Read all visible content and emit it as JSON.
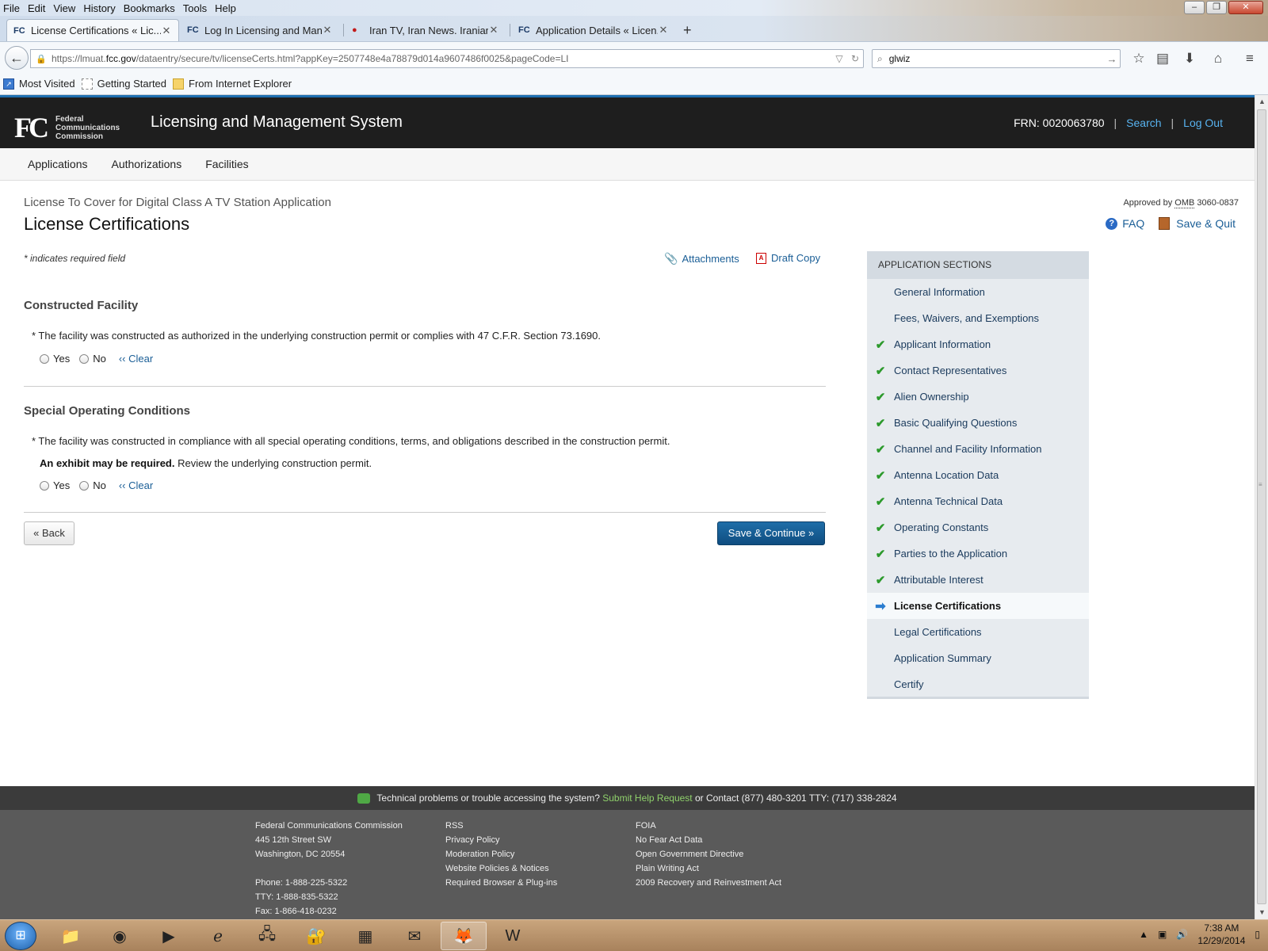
{
  "browser": {
    "menu": [
      "File",
      "Edit",
      "View",
      "History",
      "Bookmarks",
      "Tools",
      "Help"
    ],
    "tabs": [
      {
        "label": "License Certifications « Lic...",
        "favicon": "FC"
      },
      {
        "label": "Log In Licensing and Mana...",
        "favicon": "FC"
      },
      {
        "label": "Iran TV, Iran News. Iranian ...",
        "favicon": "●"
      },
      {
        "label": "Application Details « Licen...",
        "favicon": "FC"
      }
    ],
    "url_prefix": "https://lmuat.",
    "url_domain": "fcc.gov",
    "url_rest": "/dataentry/secure/tv/licenseCerts.html?appKey=2507748e4a78879d014a9607486f0025&pageCode=LI",
    "search_value": "glwiz",
    "bookmarks": [
      "Most Visited",
      "Getting Started",
      "From Internet Explorer"
    ]
  },
  "header": {
    "logo_mark": "FC",
    "agency_lines": [
      "Federal",
      "Communications",
      "Commission"
    ],
    "system_title": "Licensing and Management System",
    "frn": "FRN: 0020063780",
    "search_link": "Search",
    "logout_link": "Log Out"
  },
  "nav": [
    "Applications",
    "Authorizations",
    "Facilities"
  ],
  "page": {
    "subtitle": "License To Cover for Digital Class A TV Station Application",
    "title": "License Certifications",
    "omb_prefix": "Approved by",
    "omb_abbr": "OMB",
    "omb_number": "3060-0837",
    "faq": "FAQ",
    "save_quit": "Save & Quit",
    "required_note": "* indicates required field",
    "attachments": "Attachments",
    "draft_copy": "Draft Copy",
    "sections": [
      {
        "heading": "Constructed Facility",
        "question": "* The facility was constructed as authorized in the underlying construction permit or complies with 47 C.F.R. Section 73.1690."
      },
      {
        "heading": "Special Operating Conditions",
        "question": "* The facility was constructed in compliance with all special operating conditions, terms, and obligations described in the construction permit.",
        "exhibit_bold": "An exhibit may be required.",
        "exhibit_rest": " Review the underlying construction permit."
      }
    ],
    "yes": "Yes",
    "no": "No",
    "clear": "‹‹ Clear",
    "back": "« Back",
    "save_continue": "Save & Continue »"
  },
  "sidebar": {
    "heading": "Application Sections",
    "items": [
      {
        "label": "General Information",
        "status": "none"
      },
      {
        "label": "Fees, Waivers, and Exemptions",
        "status": "none"
      },
      {
        "label": "Applicant Information",
        "status": "complete"
      },
      {
        "label": "Contact Representatives",
        "status": "complete"
      },
      {
        "label": "Alien Ownership",
        "status": "complete"
      },
      {
        "label": "Basic Qualifying Questions",
        "status": "complete"
      },
      {
        "label": "Channel and Facility Information",
        "status": "complete"
      },
      {
        "label": "Antenna Location Data",
        "status": "complete"
      },
      {
        "label": "Antenna Technical Data",
        "status": "complete"
      },
      {
        "label": "Operating Constants",
        "status": "complete"
      },
      {
        "label": "Parties to the Application",
        "status": "complete"
      },
      {
        "label": "Attributable Interest",
        "status": "complete"
      },
      {
        "label": "License Certifications",
        "status": "current"
      },
      {
        "label": "Legal Certifications",
        "status": "none"
      },
      {
        "label": "Application Summary",
        "status": "none"
      },
      {
        "label": "Certify",
        "status": "none"
      }
    ]
  },
  "footer": {
    "bar_text": "Technical problems or trouble accessing the system?",
    "help_link": "Submit Help Request",
    "bar_contact": "or Contact (877) 480-3201 TTY: (717) 338-2824",
    "col1": [
      "Federal Communications Commission",
      "445 12th Street SW",
      "Washington, DC 20554"
    ],
    "col1b": [
      "Phone: 1-888-225-5322",
      "TTY: 1-888-835-5322",
      "Fax: 1-866-418-0232"
    ],
    "col2": [
      "RSS",
      "Privacy Policy",
      "Moderation Policy",
      "Website Policies & Notices",
      "Required Browser & Plug-ins"
    ],
    "col3": [
      "FOIA",
      "No Fear Act Data",
      "Open Government Directive",
      "Plain Writing Act",
      "2009 Recovery and Reinvestment Act"
    ]
  },
  "taskbar": {
    "time": "7:38 AM",
    "date": "12/29/2014"
  },
  "colors": {
    "link": "#1a5e96",
    "header_bg": "#1e1e1e",
    "primary_button": "#0f4d80",
    "check": "#2c9a2c"
  }
}
